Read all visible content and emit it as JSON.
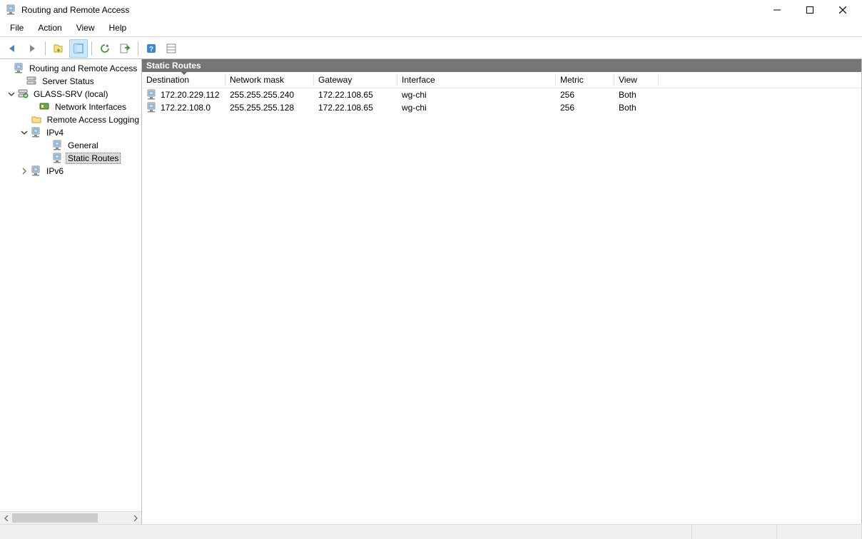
{
  "window": {
    "title": "Routing and Remote Access"
  },
  "menu": {
    "file": "File",
    "action": "Action",
    "view": "View",
    "help": "Help"
  },
  "tree": {
    "root": "Routing and Remote Access",
    "server_status": "Server Status",
    "server_name": "GLASS-SRV (local)",
    "network_interfaces": "Network Interfaces",
    "remote_access_logging": "Remote Access Logging",
    "ipv4": "IPv4",
    "ipv4_general": "General",
    "ipv4_static_routes": "Static Routes",
    "ipv6": "IPv6"
  },
  "content": {
    "header": "Static Routes",
    "columns": {
      "destination": "Destination",
      "network_mask": "Network mask",
      "gateway": "Gateway",
      "interface": "Interface",
      "metric": "Metric",
      "view": "View"
    },
    "rows": [
      {
        "destination": "172.20.229.112",
        "network_mask": "255.255.255.240",
        "gateway": "172.22.108.65",
        "interface": "wg-chi",
        "metric": "256",
        "view": "Both"
      },
      {
        "destination": "172.22.108.0",
        "network_mask": "255.255.255.128",
        "gateway": "172.22.108.65",
        "interface": "wg-chi",
        "metric": "256",
        "view": "Both"
      }
    ]
  }
}
